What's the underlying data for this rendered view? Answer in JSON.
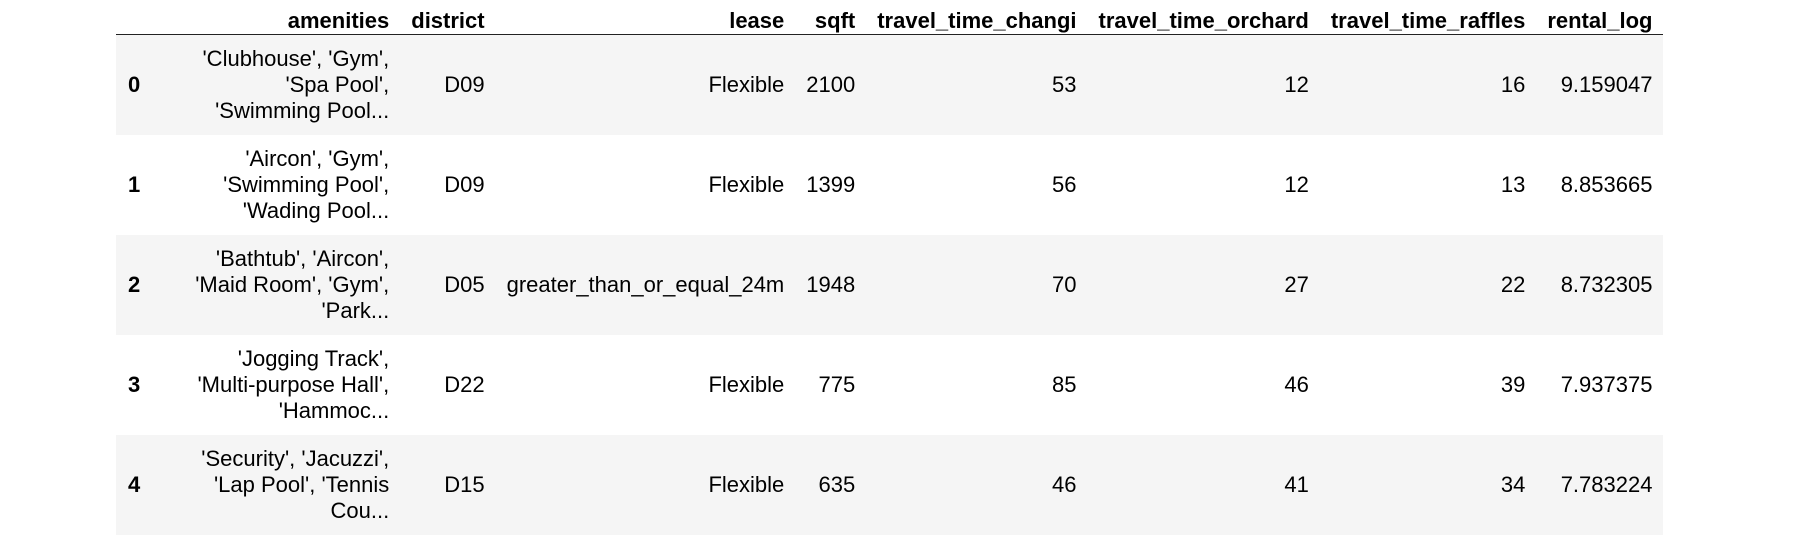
{
  "table": {
    "index_header": "",
    "columns": [
      "amenities",
      "district",
      "lease",
      "sqft",
      "travel_time_changi",
      "travel_time_orchard",
      "travel_time_raffles",
      "rental_log"
    ],
    "rows": [
      {
        "index": "0",
        "amenities": "'Clubhouse', 'Gym', 'Spa Pool', 'Swimming Pool...",
        "district": "D09",
        "lease": "Flexible",
        "sqft": "2100",
        "travel_time_changi": "53",
        "travel_time_orchard": "12",
        "travel_time_raffles": "16",
        "rental_log": "9.159047"
      },
      {
        "index": "1",
        "amenities": "'Aircon', 'Gym', 'Swimming Pool', 'Wading Pool...",
        "district": "D09",
        "lease": "Flexible",
        "sqft": "1399",
        "travel_time_changi": "56",
        "travel_time_orchard": "12",
        "travel_time_raffles": "13",
        "rental_log": "8.853665"
      },
      {
        "index": "2",
        "amenities": "'Bathtub', 'Aircon', 'Maid Room', 'Gym', 'Park...",
        "district": "D05",
        "lease": "greater_than_or_equal_24m",
        "sqft": "1948",
        "travel_time_changi": "70",
        "travel_time_orchard": "27",
        "travel_time_raffles": "22",
        "rental_log": "8.732305"
      },
      {
        "index": "3",
        "amenities": "'Jogging Track', 'Multi-purpose Hall', 'Hammoc...",
        "district": "D22",
        "lease": "Flexible",
        "sqft": "775",
        "travel_time_changi": "85",
        "travel_time_orchard": "46",
        "travel_time_raffles": "39",
        "rental_log": "7.937375"
      },
      {
        "index": "4",
        "amenities": "'Security', 'Jacuzzi', 'Lap Pool', 'Tennis Cou...",
        "district": "D15",
        "lease": "Flexible",
        "sqft": "635",
        "travel_time_changi": "46",
        "travel_time_orchard": "41",
        "travel_time_raffles": "34",
        "rental_log": "7.783224"
      }
    ]
  },
  "colors": {
    "odd_row": "#f5f5f5",
    "even_row": "#ffffff",
    "header_rule": "#222222"
  }
}
